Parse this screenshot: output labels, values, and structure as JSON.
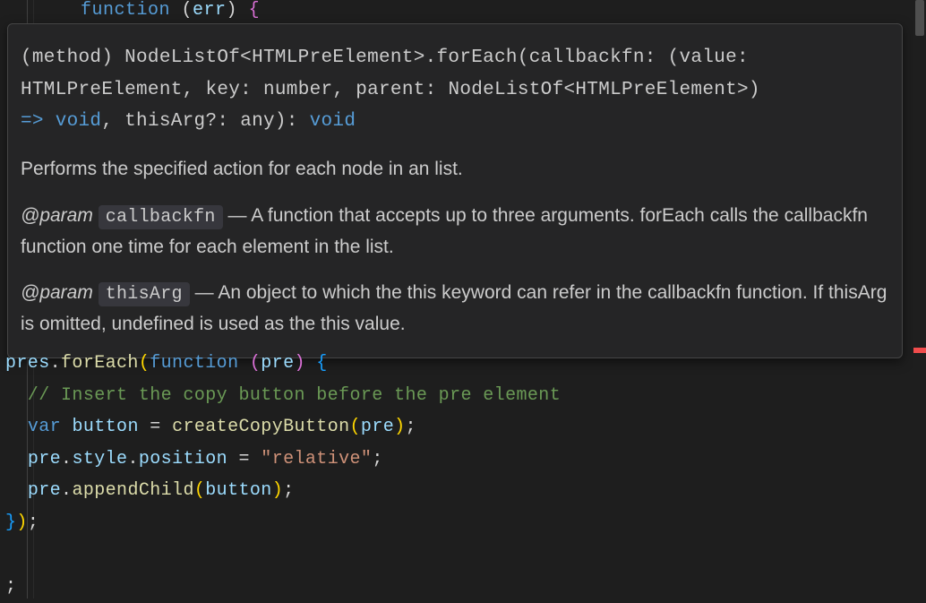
{
  "topLine": {
    "func_kw": "function",
    "params_open": " (",
    "err": "err",
    "params_close": ")",
    "brace": " {"
  },
  "hover": {
    "sig_prefix": "(method) ",
    "sig_type1": "NodeListOf",
    "sig_lt1": "<",
    "sig_type2": "HTMLPreElement",
    "sig_gt1": ">",
    "sig_dot": ".",
    "sig_method": "forEach",
    "sig_open": "(",
    "sig_p1": "callbackfn",
    "sig_colon1": ": (",
    "sig_p1a": "value",
    "sig_colon2": ": ",
    "sig_t_value": "HTMLPreElement",
    "sig_comma1": ", ",
    "sig_p1b": "key",
    "sig_colon3": ": ",
    "sig_t_key": "number",
    "sig_comma2": ", ",
    "sig_p1c": "parent",
    "sig_colon4": ": ",
    "sig_t_parent": "NodeListOf",
    "sig_lt2": "<",
    "sig_t_parent2": "HTMLPreElement",
    "sig_gt2": ">)",
    "sig_arrow": " => ",
    "sig_void1": "void",
    "sig_comma3": ", ",
    "sig_p2": "thisArg",
    "sig_opt": "?: ",
    "sig_any": "any",
    "sig_close": "): ",
    "sig_void2": "void",
    "desc": "Performs the specified action for each node in an list.",
    "param_tag": "@param",
    "p1_name": "callbackfn",
    "p1_desc": " — A function that accepts up to three arguments. forEach calls the callbackfn function one time for each element in the list.",
    "p2_name": "thisArg",
    "p2_desc": " — An object to which the this keyword can refer in the callbackfn function. If thisArg is omitted, undefined is used as the this value."
  },
  "code": {
    "l1_pres": "pres",
    "l1_dot": ".",
    "l1_foreach": "forEach",
    "l1_open": "(",
    "l1_func": "function",
    "l1_space": " ",
    "l1_paren_open": "(",
    "l1_pre": "pre",
    "l1_paren_close": ")",
    "l1_brace": " {",
    "l2": "  // Insert the copy button before the pre element",
    "l3_indent": "  ",
    "l3_var": "var",
    "l3_space": " ",
    "l3_button": "button",
    "l3_eq": " = ",
    "l3_fn": "createCopyButton",
    "l3_open": "(",
    "l3_arg": "pre",
    "l3_close": ")",
    "l3_semi": ";",
    "l4_indent": "  ",
    "l4_pre": "pre",
    "l4_dot1": ".",
    "l4_style": "style",
    "l4_dot2": ".",
    "l4_pos": "position",
    "l4_eq": " = ",
    "l4_str": "\"relative\"",
    "l4_semi": ";",
    "l5_indent": "  ",
    "l5_pre": "pre",
    "l5_dot": ".",
    "l5_append": "appendChild",
    "l5_open": "(",
    "l5_arg": "button",
    "l5_close": ")",
    "l5_semi": ";",
    "l6_close": "}",
    "l6_paren": ")",
    "l6_semi": ";",
    "l7": ";"
  }
}
